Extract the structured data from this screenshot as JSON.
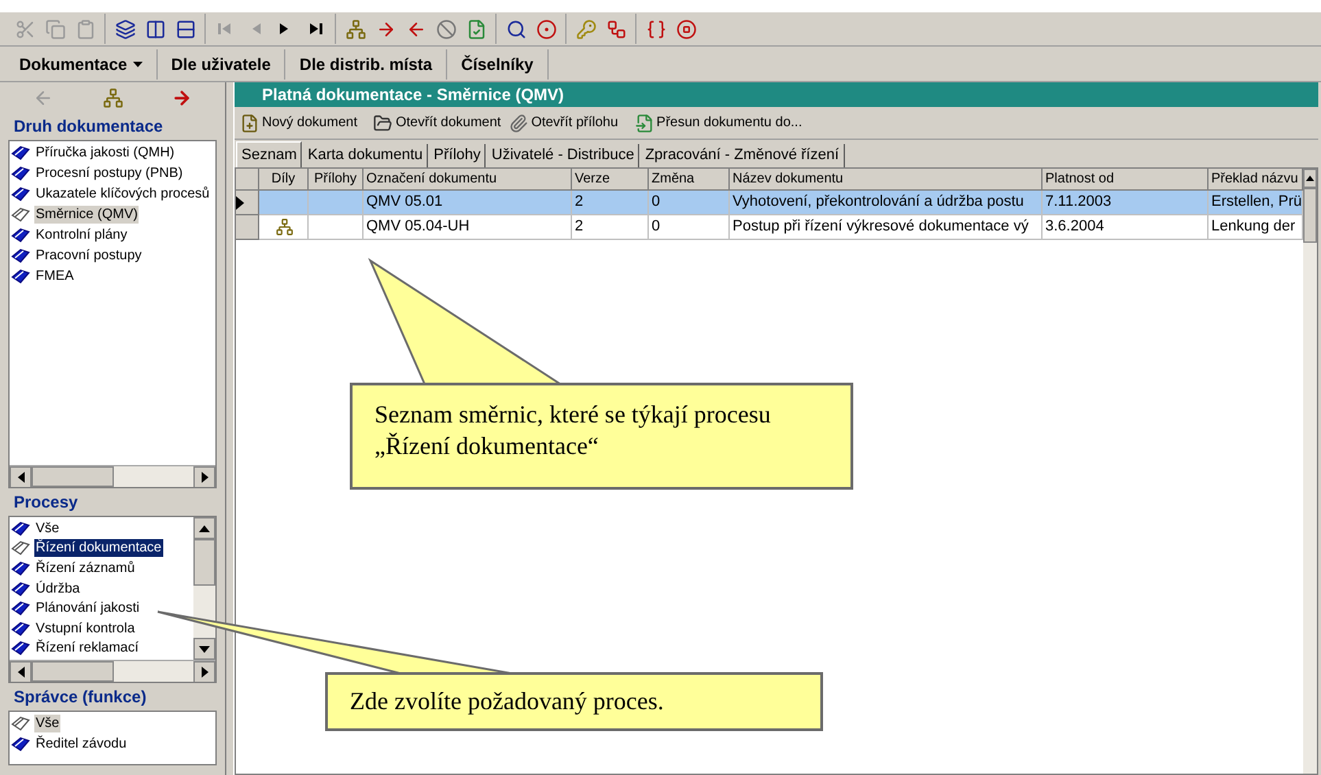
{
  "toolbar_groups": [
    [
      {
        "kind": "cut",
        "disabled": true
      },
      {
        "kind": "copy",
        "disabled": true
      },
      {
        "kind": "paste",
        "disabled": true
      }
    ],
    [
      {
        "kind": "cascade",
        "disabled": false
      },
      {
        "kind": "columns",
        "disabled": false
      },
      {
        "kind": "rows",
        "disabled": false
      }
    ],
    [
      {
        "kind": "first",
        "disabled": true
      },
      {
        "kind": "prev",
        "disabled": true
      },
      {
        "kind": "next",
        "disabled": false
      },
      {
        "kind": "last",
        "disabled": false
      }
    ],
    [
      {
        "kind": "tree",
        "disabled": false
      },
      {
        "kind": "move-right",
        "disabled": false
      },
      {
        "kind": "move-left",
        "disabled": false
      },
      {
        "kind": "cancel",
        "disabled": false
      },
      {
        "kind": "refresh",
        "disabled": false
      }
    ],
    [
      {
        "kind": "search",
        "disabled": false
      },
      {
        "kind": "record",
        "disabled": false
      }
    ],
    [
      {
        "kind": "key",
        "disabled": false
      },
      {
        "kind": "hierarchy",
        "disabled": false
      }
    ],
    [
      {
        "kind": "help",
        "disabled": false
      },
      {
        "kind": "stop",
        "disabled": false
      }
    ]
  ],
  "menu": [
    {
      "label": "Dokumentace",
      "dropdown": true
    },
    {
      "label": "Dle uživatele",
      "dropdown": false
    },
    {
      "label": "Dle distrib. místa",
      "dropdown": false
    },
    {
      "label": "Číselníky",
      "dropdown": false
    }
  ],
  "nav": [
    {
      "kind": "back",
      "disabled": true
    },
    {
      "kind": "tree",
      "disabled": false
    },
    {
      "kind": "forward",
      "disabled": false
    }
  ],
  "sections": [
    {
      "title": "Druh dokumentace",
      "focused": false,
      "items": [
        {
          "label": "Příručka jakosti (QMH)",
          "selected": false
        },
        {
          "label": "Procesní postupy (PNB)",
          "selected": false
        },
        {
          "label": "Ukazatele klíčových procesů",
          "selected": false
        },
        {
          "label": "Směrnice (QMV)",
          "selected": true
        },
        {
          "label": "Kontrolní plány",
          "selected": false
        },
        {
          "label": "Pracovní postupy",
          "selected": false
        },
        {
          "label": "FMEA",
          "selected": false
        }
      ]
    },
    {
      "title": "Procesy",
      "focused": true,
      "items": [
        {
          "label": "Vše",
          "selected": false
        },
        {
          "label": "Řízení dokumentace",
          "selected": true
        },
        {
          "label": "Řízení záznamů",
          "selected": false
        },
        {
          "label": "Údržba",
          "selected": false
        },
        {
          "label": "Plánování jakosti",
          "selected": false
        },
        {
          "label": "Vstupní kontrola",
          "selected": false
        },
        {
          "label": "Řízení reklamací",
          "selected": false
        }
      ]
    },
    {
      "title": "Správce (funkce)",
      "focused": false,
      "items": [
        {
          "label": "Vše",
          "selected": true
        },
        {
          "label": "Ředitel závodu",
          "selected": false
        }
      ]
    }
  ],
  "panel": {
    "title": "Platná dokumentace - Směrnice (QMV)",
    "actions": [
      {
        "kind": "new",
        "label": "Nový dokument"
      },
      {
        "kind": "open",
        "label": "Otevřít dokument"
      },
      {
        "kind": "attachment",
        "label": "Otevřít přílohu"
      },
      {
        "kind": "move",
        "label": "Přesun dokumentu do..."
      }
    ],
    "tabs": [
      {
        "label": "Seznam",
        "selected": true
      },
      {
        "label": "Karta dokumentu",
        "selected": false
      },
      {
        "label": "Přílohy",
        "selected": false
      },
      {
        "label": "Uživatelé - Distribuce",
        "selected": false
      },
      {
        "label": "Zpracování - Změnové řízení",
        "selected": false
      }
    ],
    "table": {
      "columns": [
        "Díly",
        "Přílohy",
        "Označení dokumentu",
        "Verze",
        "Změna",
        "Název dokumentu",
        "Platnost od",
        "Překlad názvu"
      ],
      "rows": [
        {
          "selected": true,
          "has_parts": false,
          "cells": [
            "",
            "",
            "QMV 05.01",
            "2",
            "0",
            "Vyhotovení, překontrolování a údržba postu",
            "7.11.2003",
            "Erstellen, Prü"
          ]
        },
        {
          "selected": false,
          "has_parts": true,
          "cells": [
            "",
            "",
            "QMV 05.04-UH",
            "2",
            "0",
            "Postup při řízení výkresové dokumentace vý",
            "3.6.2004",
            "Lenkung der"
          ]
        }
      ]
    }
  },
  "callouts": [
    "Seznam směrnic, které se týkají procesu „Řízení dokumentace“",
    "Zde zvolíte požadovaný proces."
  ]
}
